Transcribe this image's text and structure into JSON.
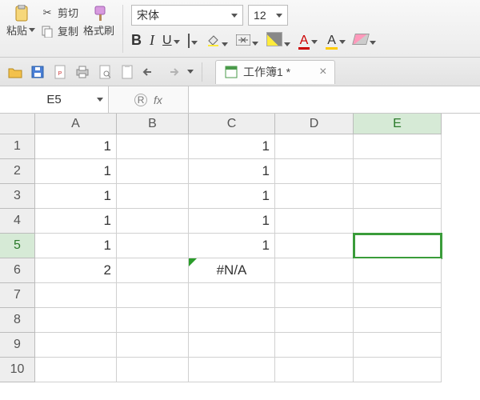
{
  "ribbon": {
    "paste_label": "粘贴",
    "cut_label": "剪切",
    "copy_label": "复制",
    "format_painter_label": "格式刷",
    "font_name": "宋体",
    "font_size": "12",
    "bold": "B",
    "italic": "I",
    "underline": "U",
    "font_color_letter": "A",
    "highlight_letter": "A"
  },
  "doc": {
    "title": "工作簿1 *"
  },
  "namebox": "E5",
  "fx_label": "fx",
  "columns": [
    "A",
    "B",
    "C",
    "D",
    "E"
  ],
  "rows": [
    "1",
    "2",
    "3",
    "4",
    "5",
    "6",
    "7",
    "8",
    "9",
    "10"
  ],
  "active_row": 5,
  "active_col": 4,
  "cells": {
    "A1": "1",
    "C1": "1",
    "A2": "1",
    "C2": "1",
    "A3": "1",
    "C3": "1",
    "A4": "1",
    "C4": "1",
    "A5": "1",
    "C5": "1",
    "A6": "2",
    "C6": "#N/A"
  }
}
